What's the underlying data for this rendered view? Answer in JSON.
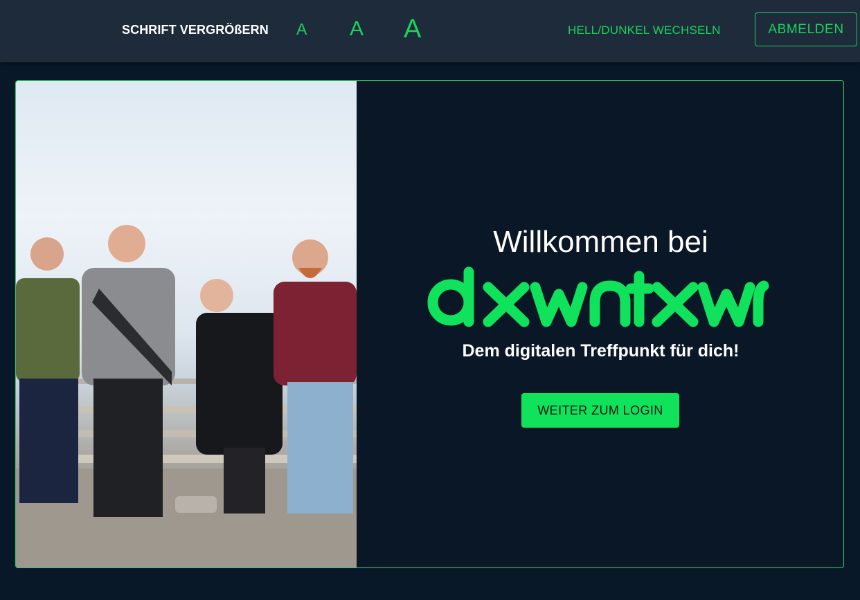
{
  "header": {
    "font_size_label": "SCHRIFT VERGRÖßERN",
    "font_small": "A",
    "font_medium": "A",
    "font_large": "A",
    "theme_toggle": "HELL/DUNKEL WECHSELN",
    "logout": "ABMELDEN"
  },
  "hero": {
    "welcome": "Willkommen bei",
    "brand": "dxwntxwn",
    "tagline": "Dem digitalen Treffpunkt für dich!",
    "login_button": "WEITER ZUM LOGIN",
    "photo_alt": "Vier lachende junge Menschen an einer Promenade"
  },
  "colors": {
    "background": "#091828",
    "header": "#1e2b3a",
    "accent": "#19d35c",
    "button": "#10e25c"
  }
}
